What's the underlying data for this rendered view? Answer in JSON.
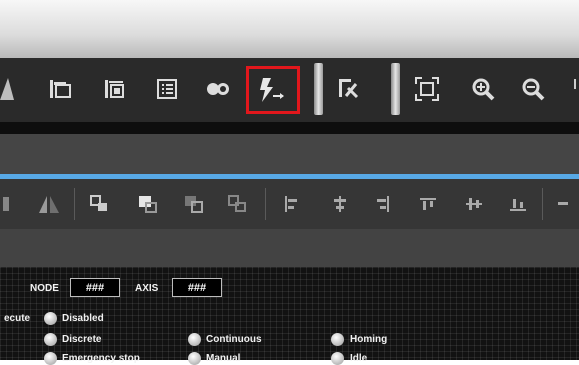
{
  "toolbar1": {
    "icons": [
      "stack-frames-icon",
      "stack-frames-2-icon",
      "stacked-frames-icon",
      "list-icon",
      "toggle-icon",
      "flash-arrow-icon",
      "edit-arrow-icon",
      "fit-screen-icon",
      "zoom-in-icon",
      "zoom-out-icon"
    ],
    "highlight_color": "#e2171c"
  },
  "toolbar2": {
    "icons": [
      "flip-icon",
      "bring-forward-icon",
      "bring-to-front-icon",
      "send-backward-icon",
      "send-to-back-icon",
      "align-left-icon",
      "align-center-icon",
      "align-right-icon",
      "align-top-icon",
      "align-middle-icon",
      "align-bottom-icon"
    ]
  },
  "panel": {
    "node_label": "NODE",
    "node_value": "###",
    "axis_label": "AXIS",
    "axis_value": "###",
    "execute_label": "ecute",
    "options": {
      "disabled": "Disabled",
      "discrete": "Discrete",
      "continuous": "Continuous",
      "homing": "Homing",
      "e_stop": "Emergency stop",
      "manual": "Manual",
      "idle": "Idle"
    }
  },
  "colors": {
    "accent_blue": "#58a9e6",
    "highlight_red": "#e2171c"
  }
}
